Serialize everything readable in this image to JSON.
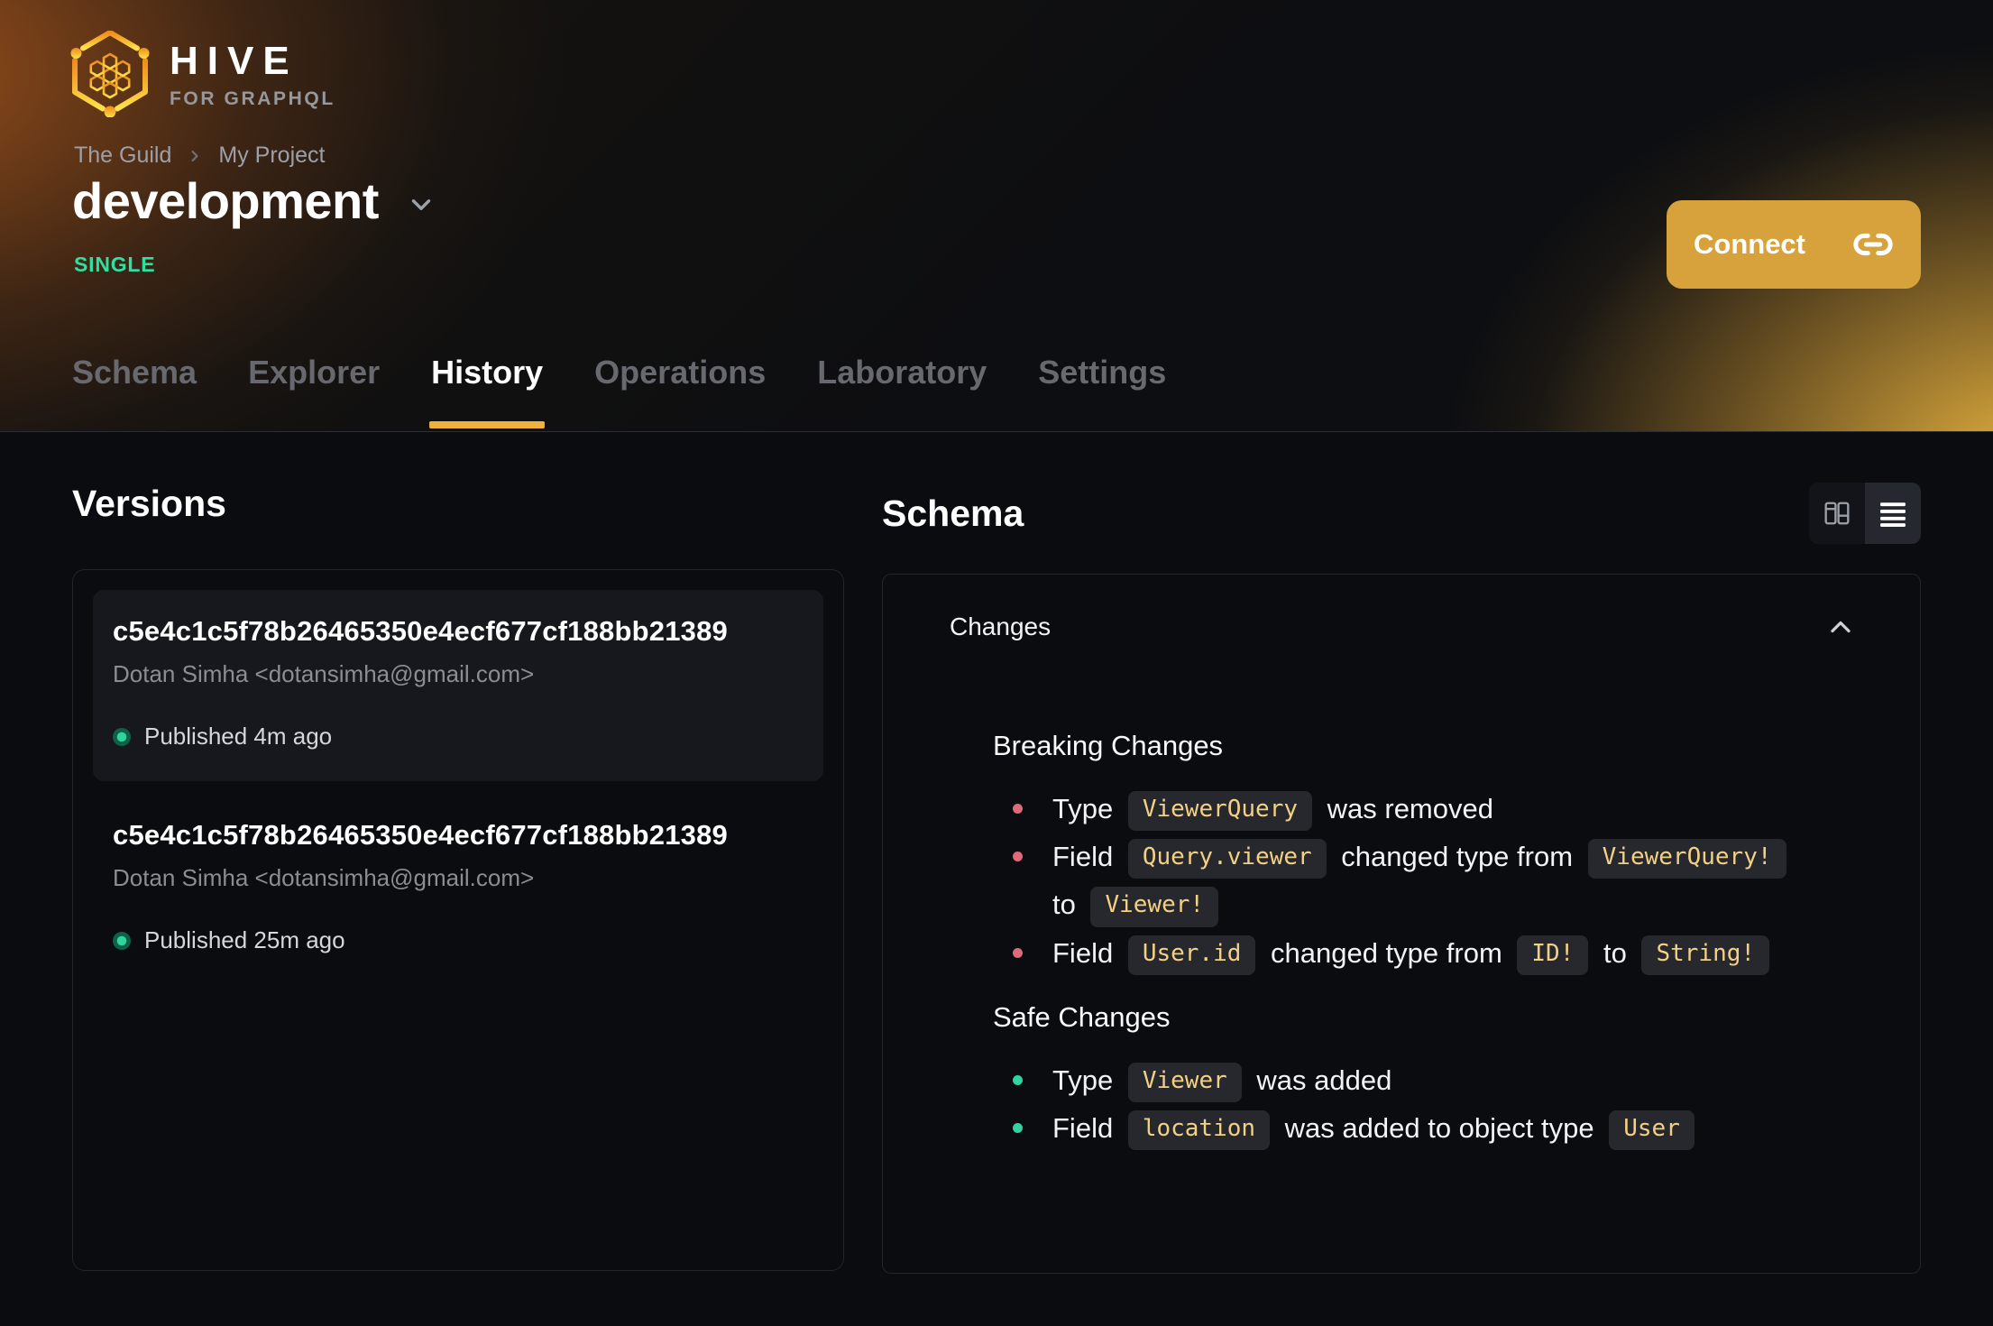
{
  "brand": {
    "name": "HIVE",
    "tagline": "FOR GRAPHQL"
  },
  "breadcrumb": [
    "The Guild",
    "My Project"
  ],
  "target": {
    "name": "development",
    "badge": "SINGLE"
  },
  "connect": {
    "label": "Connect"
  },
  "tabs": [
    {
      "label": "Schema",
      "active": false
    },
    {
      "label": "Explorer",
      "active": false
    },
    {
      "label": "History",
      "active": true
    },
    {
      "label": "Operations",
      "active": false
    },
    {
      "label": "Laboratory",
      "active": false
    },
    {
      "label": "Settings",
      "active": false
    }
  ],
  "versions": {
    "title": "Versions",
    "items": [
      {
        "hash": "c5e4c1c5f78b26465350e4ecf677cf188bb21389",
        "author": "Dotan Simha <dotansimha@gmail.com>",
        "status": "Published 4m ago",
        "highlighted": true
      },
      {
        "hash": "c5e4c1c5f78b26465350e4ecf677cf188bb21389",
        "author": "Dotan Simha <dotansimha@gmail.com>",
        "status": "Published 25m ago",
        "highlighted": false
      }
    ]
  },
  "schema": {
    "title": "Schema",
    "view_modes": [
      {
        "icon": "split-columns-icon",
        "active": false
      },
      {
        "icon": "list-lines-icon",
        "active": true
      }
    ],
    "changes": {
      "title": "Changes",
      "sections": [
        {
          "title": "Breaking Changes",
          "kind": "breaking",
          "items": [
            [
              {
                "t": "Type "
              },
              {
                "c": "ViewerQuery"
              },
              {
                "t": " was removed"
              }
            ],
            [
              {
                "t": "Field "
              },
              {
                "c": "Query.viewer"
              },
              {
                "t": " changed type from "
              },
              {
                "c": "ViewerQuery!"
              },
              {
                "nowrap": [
                  {
                    "t": "to "
                  },
                  {
                    "c": "Viewer!"
                  }
                ]
              }
            ],
            [
              {
                "t": "Field "
              },
              {
                "c": "User.id"
              },
              {
                "t": " changed type from "
              },
              {
                "c": "ID!"
              },
              {
                "t": " to "
              },
              {
                "c": "String!"
              }
            ]
          ]
        },
        {
          "title": "Safe Changes",
          "kind": "safe",
          "items": [
            [
              {
                "t": "Type "
              },
              {
                "c": "Viewer"
              },
              {
                "t": " was added"
              }
            ],
            [
              {
                "t": "Field "
              },
              {
                "c": "location"
              },
              {
                "t": " was added to object type "
              },
              {
                "c": "User"
              }
            ]
          ]
        }
      ]
    }
  },
  "icons": {
    "logo": "hive-hexagon-logo",
    "breadcrumb_separator": "chevron-right-icon",
    "target_dropdown": "chevron-down-icon",
    "connect": "link-icon",
    "changes_collapse": "chevron-up-icon",
    "view_columns": "split-columns-icon",
    "view_list": "list-lines-icon",
    "published": "green-dot-icon"
  },
  "colors": {
    "page_bg": "#0b0c0f",
    "border": "#232529",
    "card_bg": "#17181d",
    "accent": "#d7a23c",
    "tab_underline": "#eeb23c",
    "badge_green": "#2fe0a2",
    "published_dot_inner": "#2dd49b",
    "published_dot_outer": "#0e6148",
    "breaking_bullet": "#e0697a",
    "safe_bullet": "#2fd4a0",
    "code_text": "#f2d184",
    "code_chip_bg": "#27282d"
  }
}
